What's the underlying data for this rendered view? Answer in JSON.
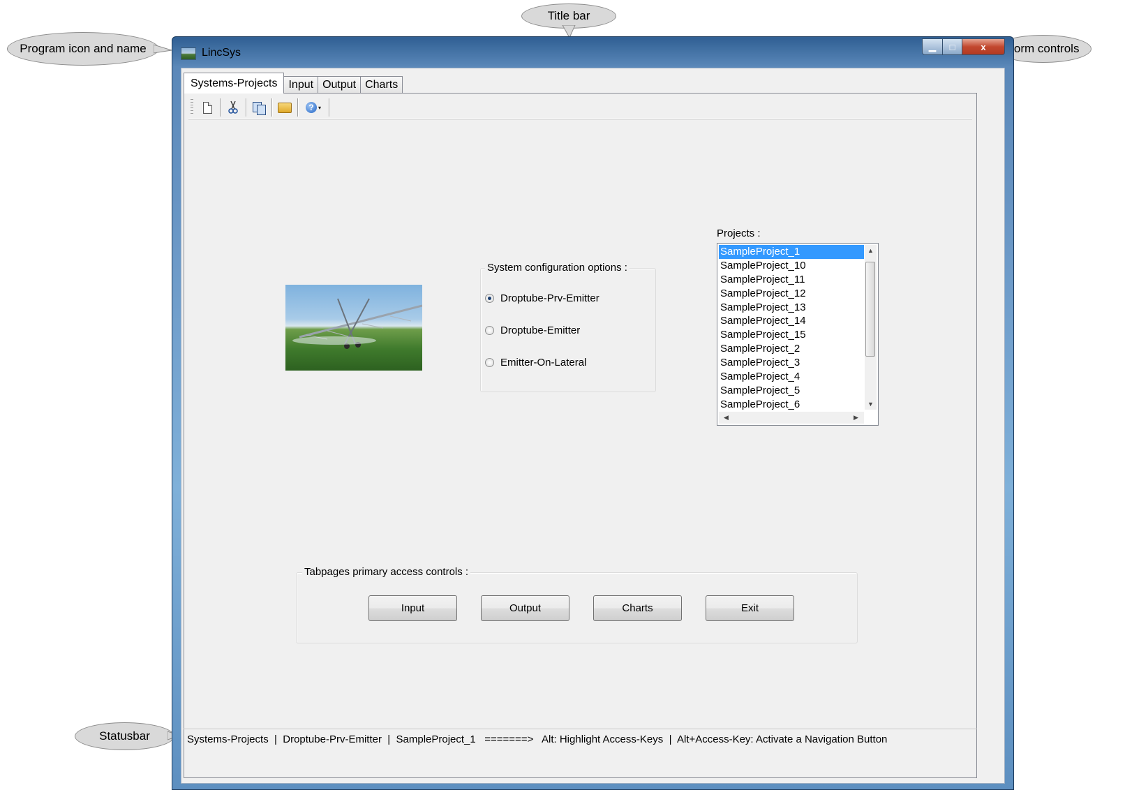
{
  "callouts": {
    "title_bar": "Title bar",
    "program_icon": "Program icon and name",
    "form_controls": "Form controls",
    "statusbar": "Statusbar"
  },
  "window": {
    "title": "LincSys",
    "controls": {
      "minimize": "▁",
      "maximize": "□",
      "close": "x"
    }
  },
  "tabs": [
    "Systems-Projects",
    "Input",
    "Output",
    "Charts"
  ],
  "toolbar": {
    "icons": [
      "new-document-icon",
      "cut-icon",
      "copy-icon",
      "open-folder-icon",
      "help-icon"
    ],
    "help_glyph": "?",
    "dropdown_glyph": "▾"
  },
  "system_config": {
    "legend": "System configuration options :",
    "options": [
      "Droptube-Prv-Emitter",
      "Droptube-Emitter",
      "Emitter-On-Lateral"
    ],
    "selected": "Droptube-Prv-Emitter"
  },
  "projects": {
    "label": "Projects :",
    "items": [
      "SampleProject_1",
      "SampleProject_10",
      "SampleProject_11",
      "SampleProject_12",
      "SampleProject_13",
      "SampleProject_14",
      "SampleProject_15",
      "SampleProject_2",
      "SampleProject_3",
      "SampleProject_4",
      "SampleProject_5",
      "SampleProject_6"
    ],
    "selected": "SampleProject_1"
  },
  "access_controls": {
    "legend": "Tabpages primary access controls :",
    "buttons": [
      "Input",
      "Output",
      "Charts",
      "Exit"
    ]
  },
  "statusbar": {
    "text": "Systems-Projects  |  Droptube-Prv-Emitter  |  SampleProject_1   =======>   Alt: Highlight Access-Keys  |  Alt+Access-Key: Activate a Navigation Button"
  },
  "colors": {
    "selection": "#3399ff",
    "close_button": "#c2482f",
    "window_frame": "#2f5f93"
  }
}
